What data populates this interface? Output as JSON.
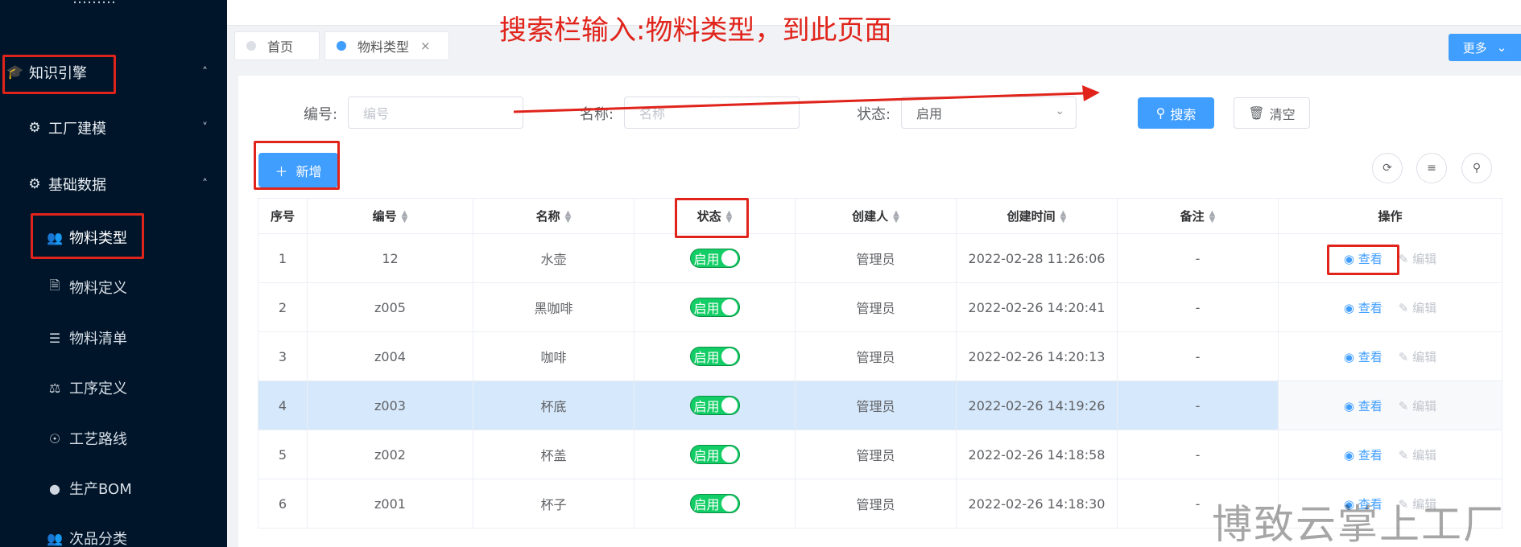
{
  "sidebar": {
    "top_cut_text": "………",
    "groups": [
      {
        "icon": "graduation-cap-icon",
        "label": "知识引擎",
        "chevron": "˄"
      },
      {
        "icon": "gear-icon",
        "label": "工厂建模",
        "chevron": "˅"
      },
      {
        "icon": "gear-icon",
        "label": "基础数据",
        "chevron": "˄"
      }
    ],
    "items": [
      {
        "icon": "users-icon",
        "label": "物料类型"
      },
      {
        "icon": "document-icon",
        "label": "物料定义"
      },
      {
        "icon": "list-icon",
        "label": "物料清单"
      },
      {
        "icon": "process-icon",
        "label": "工序定义"
      },
      {
        "icon": "route-icon",
        "label": "工艺路线"
      },
      {
        "icon": "bom-icon",
        "label": "生产BOM"
      },
      {
        "icon": "users-icon",
        "label": "次品分类"
      }
    ]
  },
  "tabs": {
    "items": [
      {
        "label": "首页"
      },
      {
        "label": "物料类型"
      }
    ],
    "close_glyph": "×",
    "more_label": "更多"
  },
  "filters": {
    "code_label": "编号:",
    "code_placeholder": "编号",
    "name_label": "名称:",
    "name_placeholder": "名称",
    "status_label": "状态:",
    "status_value": "启用",
    "search_label": "搜索",
    "clear_label": "清空"
  },
  "toolbar": {
    "add_label": "新增"
  },
  "table": {
    "headers": [
      "序号",
      "编号",
      "名称",
      "状态",
      "创建人",
      "创建时间",
      "备注",
      "操作"
    ],
    "switch_label": "启用",
    "view_label": "查看",
    "edit_label": "编辑",
    "rows": [
      {
        "index": "1",
        "code": "12",
        "name": "水壶",
        "creator": "管理员",
        "created": "2022-02-28 11:26:06",
        "remark": "-"
      },
      {
        "index": "2",
        "code": "z005",
        "name": "黑咖啡",
        "creator": "管理员",
        "created": "2022-02-26 14:20:41",
        "remark": "-"
      },
      {
        "index": "3",
        "code": "z004",
        "name": "咖啡",
        "creator": "管理员",
        "created": "2022-02-26 14:20:13",
        "remark": "-"
      },
      {
        "index": "4",
        "code": "z003",
        "name": "杯底",
        "creator": "管理员",
        "created": "2022-02-26 14:19:26",
        "remark": "-"
      },
      {
        "index": "5",
        "code": "z002",
        "name": "杯盖",
        "creator": "管理员",
        "created": "2022-02-26 14:18:58",
        "remark": "-"
      },
      {
        "index": "6",
        "code": "z001",
        "name": "杯子",
        "creator": "管理员",
        "created": "2022-02-26 14:18:30",
        "remark": "-"
      }
    ]
  },
  "annotation": {
    "text": "搜索栏输入:物料类型，到此页面",
    "color": "#e0241b"
  },
  "watermark": "博致云掌上工厂",
  "colors": {
    "sidebar_bg": "#001529",
    "primary": "#409eff",
    "switch_on": "#13ce66",
    "highlight_row": "#d6e8fb"
  }
}
